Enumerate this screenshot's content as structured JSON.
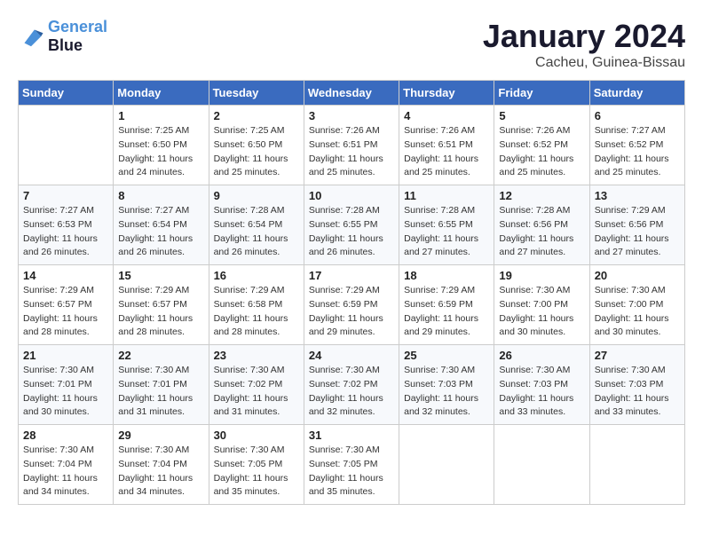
{
  "header": {
    "logo_line1": "General",
    "logo_line2": "Blue",
    "month": "January 2024",
    "location": "Cacheu, Guinea-Bissau"
  },
  "days": [
    "Sunday",
    "Monday",
    "Tuesday",
    "Wednesday",
    "Thursday",
    "Friday",
    "Saturday"
  ],
  "weeks": [
    [
      {
        "num": "",
        "sunrise": "",
        "sunset": "",
        "daylight": ""
      },
      {
        "num": "1",
        "sunrise": "7:25 AM",
        "sunset": "6:50 PM",
        "daylight": "11 hours and 24 minutes."
      },
      {
        "num": "2",
        "sunrise": "7:25 AM",
        "sunset": "6:50 PM",
        "daylight": "11 hours and 25 minutes."
      },
      {
        "num": "3",
        "sunrise": "7:26 AM",
        "sunset": "6:51 PM",
        "daylight": "11 hours and 25 minutes."
      },
      {
        "num": "4",
        "sunrise": "7:26 AM",
        "sunset": "6:51 PM",
        "daylight": "11 hours and 25 minutes."
      },
      {
        "num": "5",
        "sunrise": "7:26 AM",
        "sunset": "6:52 PM",
        "daylight": "11 hours and 25 minutes."
      },
      {
        "num": "6",
        "sunrise": "7:27 AM",
        "sunset": "6:52 PM",
        "daylight": "11 hours and 25 minutes."
      }
    ],
    [
      {
        "num": "7",
        "sunrise": "7:27 AM",
        "sunset": "6:53 PM",
        "daylight": "11 hours and 26 minutes."
      },
      {
        "num": "8",
        "sunrise": "7:27 AM",
        "sunset": "6:54 PM",
        "daylight": "11 hours and 26 minutes."
      },
      {
        "num": "9",
        "sunrise": "7:28 AM",
        "sunset": "6:54 PM",
        "daylight": "11 hours and 26 minutes."
      },
      {
        "num": "10",
        "sunrise": "7:28 AM",
        "sunset": "6:55 PM",
        "daylight": "11 hours and 26 minutes."
      },
      {
        "num": "11",
        "sunrise": "7:28 AM",
        "sunset": "6:55 PM",
        "daylight": "11 hours and 27 minutes."
      },
      {
        "num": "12",
        "sunrise": "7:28 AM",
        "sunset": "6:56 PM",
        "daylight": "11 hours and 27 minutes."
      },
      {
        "num": "13",
        "sunrise": "7:29 AM",
        "sunset": "6:56 PM",
        "daylight": "11 hours and 27 minutes."
      }
    ],
    [
      {
        "num": "14",
        "sunrise": "7:29 AM",
        "sunset": "6:57 PM",
        "daylight": "11 hours and 28 minutes."
      },
      {
        "num": "15",
        "sunrise": "7:29 AM",
        "sunset": "6:57 PM",
        "daylight": "11 hours and 28 minutes."
      },
      {
        "num": "16",
        "sunrise": "7:29 AM",
        "sunset": "6:58 PM",
        "daylight": "11 hours and 28 minutes."
      },
      {
        "num": "17",
        "sunrise": "7:29 AM",
        "sunset": "6:59 PM",
        "daylight": "11 hours and 29 minutes."
      },
      {
        "num": "18",
        "sunrise": "7:29 AM",
        "sunset": "6:59 PM",
        "daylight": "11 hours and 29 minutes."
      },
      {
        "num": "19",
        "sunrise": "7:30 AM",
        "sunset": "7:00 PM",
        "daylight": "11 hours and 30 minutes."
      },
      {
        "num": "20",
        "sunrise": "7:30 AM",
        "sunset": "7:00 PM",
        "daylight": "11 hours and 30 minutes."
      }
    ],
    [
      {
        "num": "21",
        "sunrise": "7:30 AM",
        "sunset": "7:01 PM",
        "daylight": "11 hours and 30 minutes."
      },
      {
        "num": "22",
        "sunrise": "7:30 AM",
        "sunset": "7:01 PM",
        "daylight": "11 hours and 31 minutes."
      },
      {
        "num": "23",
        "sunrise": "7:30 AM",
        "sunset": "7:02 PM",
        "daylight": "11 hours and 31 minutes."
      },
      {
        "num": "24",
        "sunrise": "7:30 AM",
        "sunset": "7:02 PM",
        "daylight": "11 hours and 32 minutes."
      },
      {
        "num": "25",
        "sunrise": "7:30 AM",
        "sunset": "7:03 PM",
        "daylight": "11 hours and 32 minutes."
      },
      {
        "num": "26",
        "sunrise": "7:30 AM",
        "sunset": "7:03 PM",
        "daylight": "11 hours and 33 minutes."
      },
      {
        "num": "27",
        "sunrise": "7:30 AM",
        "sunset": "7:03 PM",
        "daylight": "11 hours and 33 minutes."
      }
    ],
    [
      {
        "num": "28",
        "sunrise": "7:30 AM",
        "sunset": "7:04 PM",
        "daylight": "11 hours and 34 minutes."
      },
      {
        "num": "29",
        "sunrise": "7:30 AM",
        "sunset": "7:04 PM",
        "daylight": "11 hours and 34 minutes."
      },
      {
        "num": "30",
        "sunrise": "7:30 AM",
        "sunset": "7:05 PM",
        "daylight": "11 hours and 35 minutes."
      },
      {
        "num": "31",
        "sunrise": "7:30 AM",
        "sunset": "7:05 PM",
        "daylight": "11 hours and 35 minutes."
      },
      {
        "num": "",
        "sunrise": "",
        "sunset": "",
        "daylight": ""
      },
      {
        "num": "",
        "sunrise": "",
        "sunset": "",
        "daylight": ""
      },
      {
        "num": "",
        "sunrise": "",
        "sunset": "",
        "daylight": ""
      }
    ]
  ]
}
